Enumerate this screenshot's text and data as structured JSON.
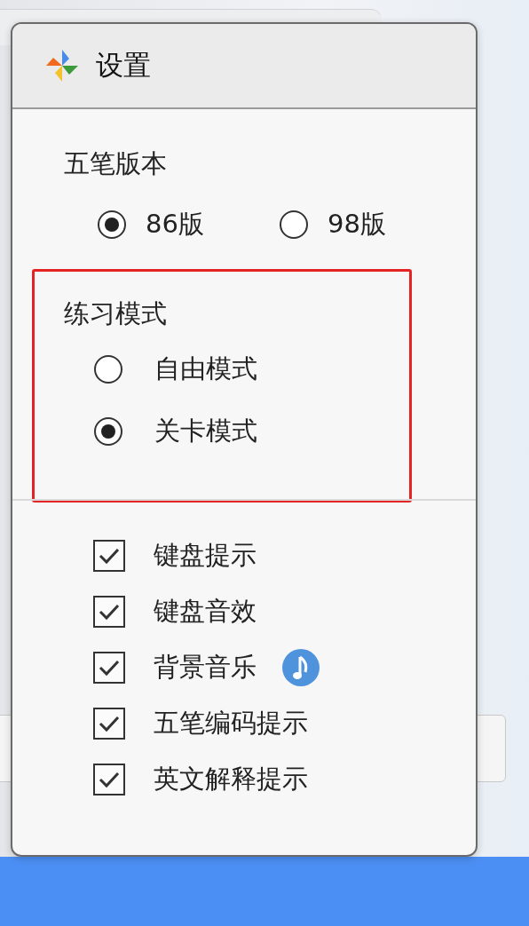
{
  "dialog": {
    "title": "设置"
  },
  "version": {
    "label": "五笔版本",
    "options": [
      {
        "label": "86版",
        "selected": true
      },
      {
        "label": "98版",
        "selected": false
      }
    ]
  },
  "mode": {
    "label": "练习模式",
    "options": [
      {
        "label": "自由模式",
        "selected": false
      },
      {
        "label": "关卡模式",
        "selected": true
      }
    ]
  },
  "checks": [
    {
      "label": "键盘提示",
      "checked": true,
      "kind": "plain"
    },
    {
      "label": "键盘音效",
      "checked": true,
      "kind": "plain"
    },
    {
      "label": "背景音乐",
      "checked": true,
      "kind": "music"
    },
    {
      "label": "五笔编码提示",
      "checked": true,
      "kind": "plain"
    },
    {
      "label": "英文解释提示",
      "checked": true,
      "kind": "plain"
    }
  ]
}
